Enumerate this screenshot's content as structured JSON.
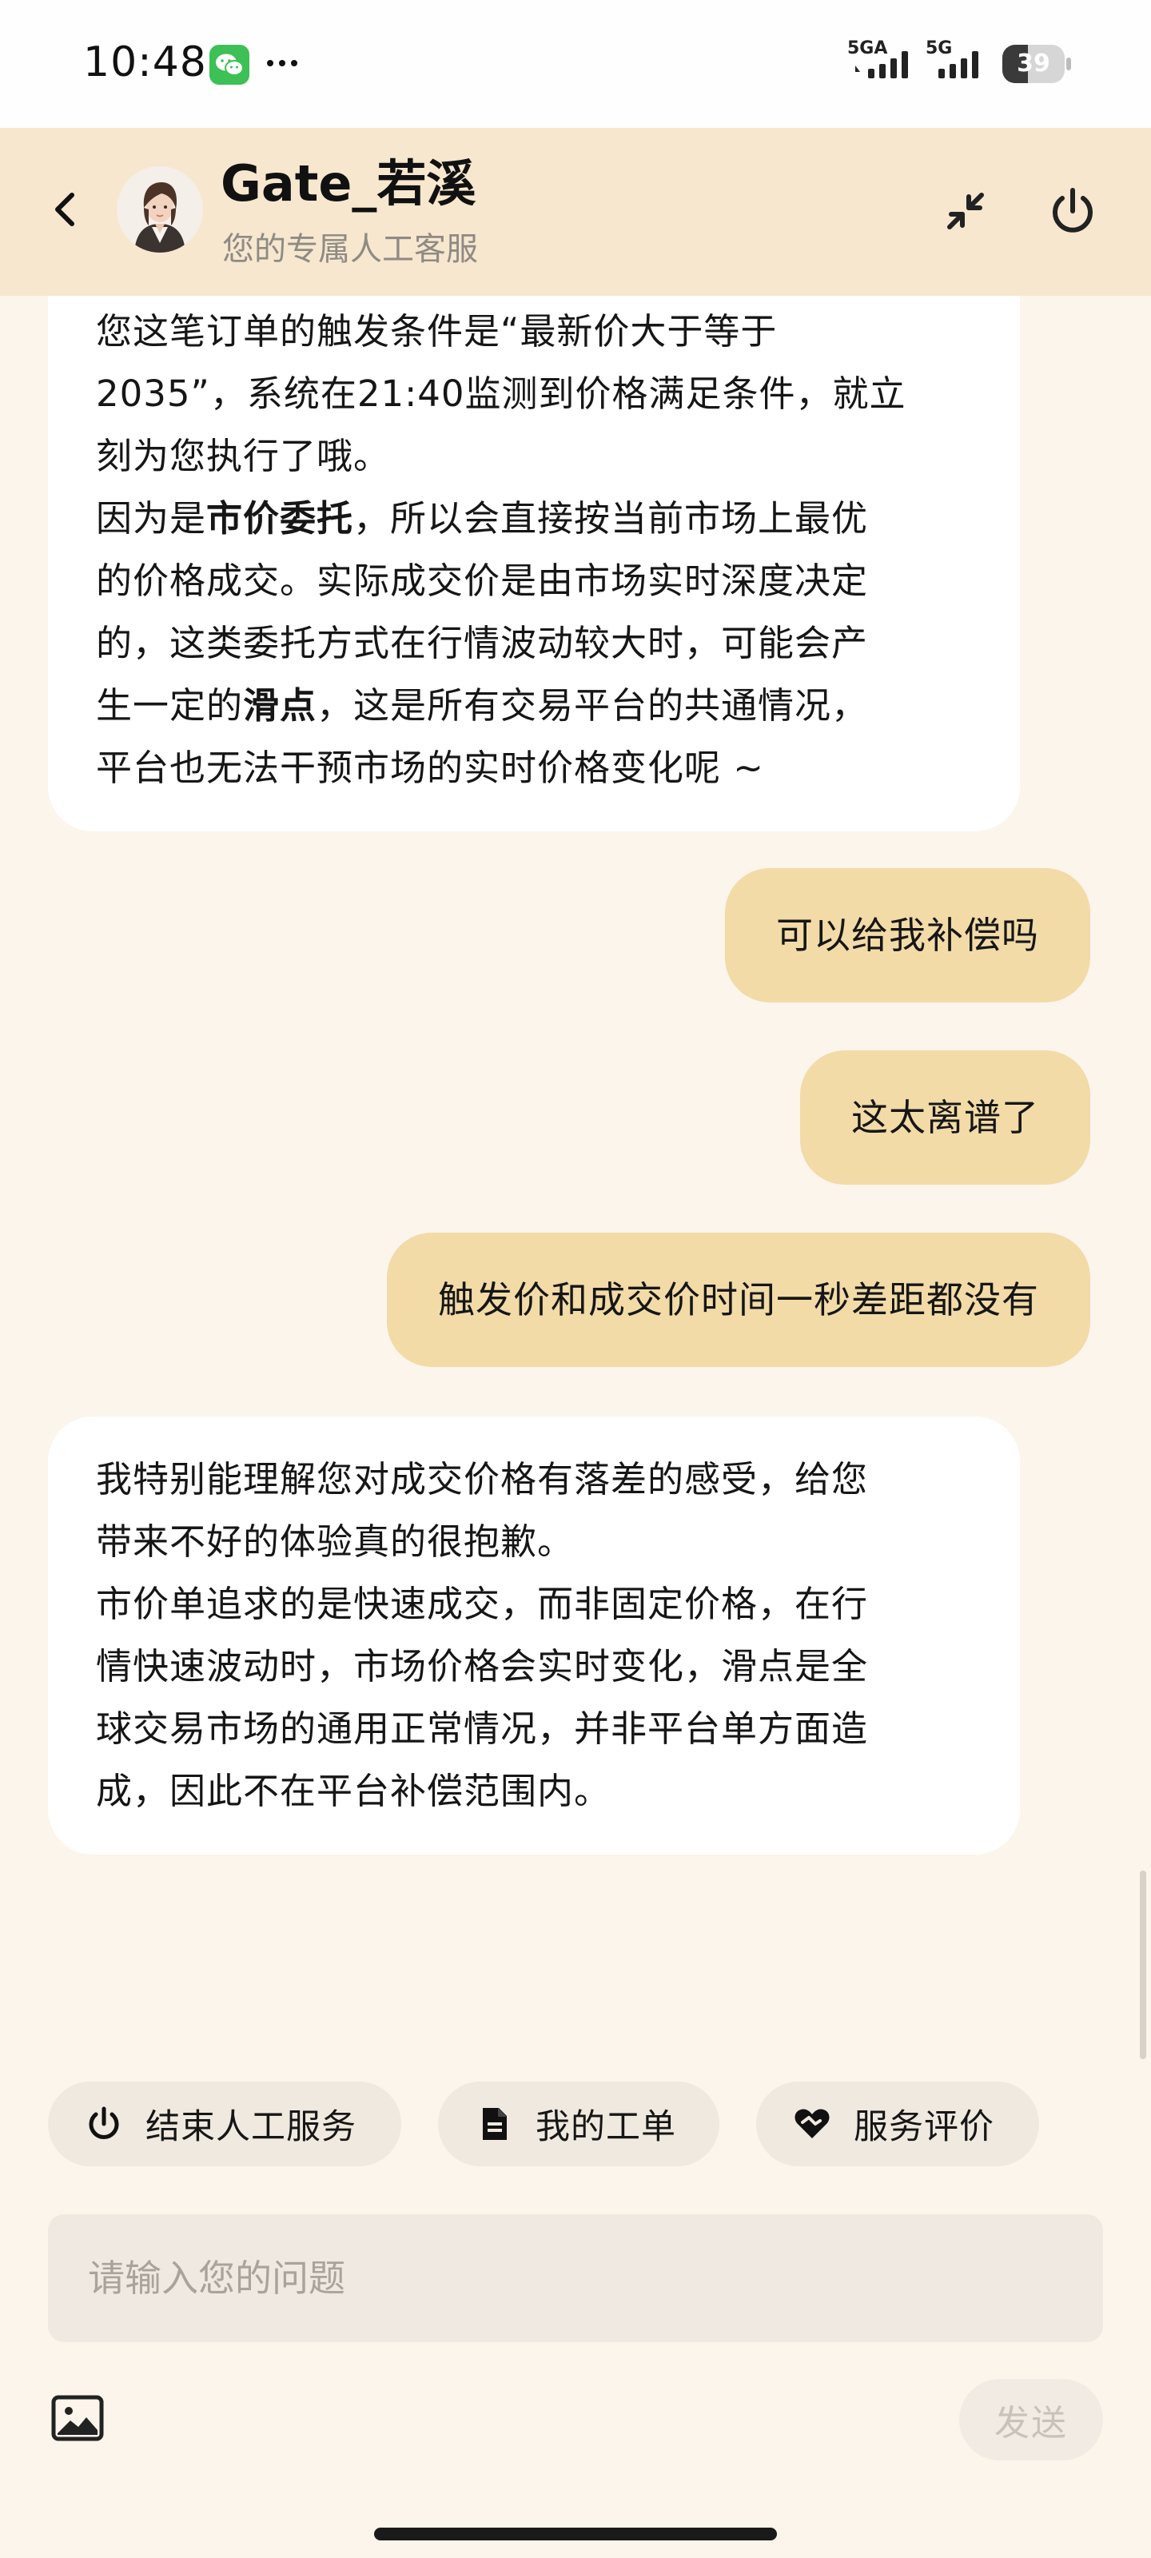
{
  "status_bar": {
    "time": "10:48",
    "network_1": "5GA",
    "network_2": "5G",
    "battery": "39",
    "wechat_icon": "wechat-icon",
    "more_icon": "more-dots-icon"
  },
  "header": {
    "agent_name": "Gate_若溪",
    "subtitle": "您的专属人工客服",
    "back_icon": "chevron-left-icon",
    "minimize_icon": "minimize-arrows-icon",
    "end_icon": "power-icon"
  },
  "messages": [
    {
      "role": "agent",
      "lines": [
        "您这笔订单的触发条件是“最新价大于等于",
        "2035”，系统在21:40监测到价格满足条件，就立",
        "刻为您执行了哦。"
      ],
      "para2_prefix": "因为是",
      "para2_bold1": "市价委托",
      "para2_line1_suffix": "，所以会直接按当前市场上最优",
      "para2_line2": "的价格成交。实际成交价是由市场实时深度决定",
      "para2_line3": "的，这类委托方式在行情波动较大时，可能会产",
      "para2_line4_prefix": "生一定的",
      "para2_bold2": "滑点",
      "para2_line4_suffix": "，这是所有交易平台的共通情况，",
      "para2_line5": "平台也无法干预市场的实时价格变化呢 ~"
    },
    {
      "role": "user",
      "text": "可以给我补偿吗"
    },
    {
      "role": "user",
      "text": "这太离谱了"
    },
    {
      "role": "user",
      "text": "触发价和成交价时间一秒差距都没有"
    },
    {
      "role": "agent",
      "lines": [
        "我特别能理解您对成交价格有落差的感受，给您",
        "带来不好的体验真的很抱歉。",
        "市价单追求的是快速成交，而非固定价格，在行",
        "情快速波动时，市场价格会实时变化，滑点是全",
        "球交易市场的通用正常情况，并非平台单方面造",
        "成，因此不在平台补偿范围内。"
      ]
    }
  ],
  "quick_actions": [
    {
      "label": "结束人工服务",
      "icon": "power-icon"
    },
    {
      "label": "我的工单",
      "icon": "document-icon"
    },
    {
      "label": "服务评价",
      "icon": "heart-handshake-icon"
    }
  ],
  "composer": {
    "placeholder": "请输入您的问题",
    "send_label": "发送",
    "image_icon": "image-icon"
  },
  "colors": {
    "header_bg": "#f6e7ce",
    "page_bg": "#fbf5ec",
    "user_bubble": "#f2dba7",
    "agent_bubble": "#ffffff"
  }
}
